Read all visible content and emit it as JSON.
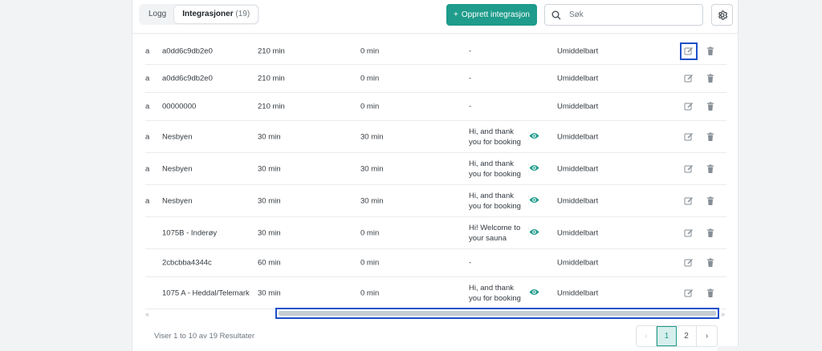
{
  "tabs": [
    {
      "label": "Logg",
      "count": ""
    },
    {
      "label": "Integrasjoner",
      "count": "(19)"
    }
  ],
  "create_button": {
    "icon": "plus-icon",
    "label": "Opprett integrasjon"
  },
  "search": {
    "placeholder": "Søk",
    "value": ""
  },
  "settings": {
    "icon": "gear-icon"
  },
  "rows": [
    {
      "stub": "a",
      "name": "a0dd6c9db2e0",
      "before": "210 min",
      "after": "0 min",
      "message": "-",
      "has_preview": false,
      "timing": "Umiddelbart"
    },
    {
      "stub": "a",
      "name": "a0dd6c9db2e0",
      "before": "210 min",
      "after": "0 min",
      "message": "-",
      "has_preview": false,
      "timing": "Umiddelbart"
    },
    {
      "stub": "a",
      "name": "00000000",
      "before": "210 min",
      "after": "0 min",
      "message": "-",
      "has_preview": false,
      "timing": "Umiddelbart"
    },
    {
      "stub": "a",
      "name": "Nesbyen",
      "before": "30 min",
      "after": "30 min",
      "message": "Hi, and thank you for booking",
      "has_preview": true,
      "timing": "Umiddelbart"
    },
    {
      "stub": "a",
      "name": "Nesbyen",
      "before": "30 min",
      "after": "30 min",
      "message": "Hi, and thank you for booking",
      "has_preview": true,
      "timing": "Umiddelbart"
    },
    {
      "stub": "a",
      "name": "Nesbyen",
      "before": "30 min",
      "after": "30 min",
      "message": "Hi, and thank you for booking",
      "has_preview": true,
      "timing": "Umiddelbart"
    },
    {
      "stub": "",
      "name": "1075B - Inderøy",
      "before": "30 min",
      "after": "0 min",
      "message": "Hi! Welcome to your sauna",
      "has_preview": true,
      "timing": "Umiddelbart"
    },
    {
      "stub": "",
      "name": "2cbcbba4344c",
      "before": "60 min",
      "after": "0 min",
      "message": "-",
      "has_preview": false,
      "timing": "Umiddelbart"
    },
    {
      "stub": "",
      "name": "1075 A - Heddal/Telemark",
      "before": "30 min",
      "after": "0 min",
      "message": "Hi, and thank you for booking",
      "has_preview": true,
      "timing": "Umiddelbart"
    }
  ],
  "scroll": {
    "left_arrow": "«",
    "right_arrow": "»"
  },
  "footer": {
    "results": "Viser 1 to 10 av 19 Resultater"
  },
  "pagination": {
    "prev": "‹",
    "pages": [
      "1",
      "2"
    ],
    "current": "1",
    "next": "›"
  },
  "colors": {
    "accent": "#1f9c8b",
    "focus": "#1e50c8"
  }
}
